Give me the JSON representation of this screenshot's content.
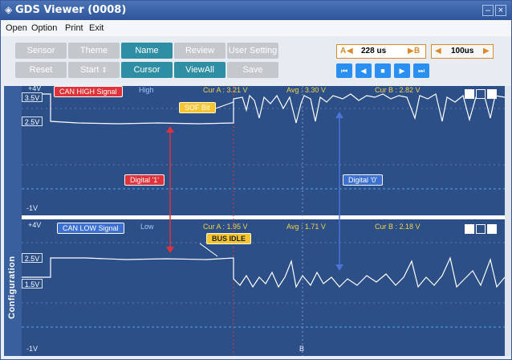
{
  "window": {
    "title": "GDS Viewer (0008)"
  },
  "menu": {
    "items": [
      "Open",
      "Option",
      "Print",
      "Exit"
    ]
  },
  "toolbar": {
    "row1": [
      "Sensor",
      "Theme",
      "Name",
      "Review",
      "User Setting"
    ],
    "row2": [
      "Reset",
      "Start",
      "Cursor",
      "ViewAll",
      "Save"
    ],
    "time_a_label": "A",
    "time_a_value": "228 us",
    "time_b_label": "B",
    "timebase_value": "100us"
  },
  "sidebar": {
    "label": "Configuration"
  },
  "top_channel": {
    "scale_top": "+4V",
    "scale_bottom": "-1V",
    "level_high": "3.5V",
    "level_low": "2.5V",
    "signal_name": "CAN HIGH Signal",
    "state": "High",
    "cur_a": "Cur A : 3.21 V",
    "avg": "Avg : 3.30 V",
    "cur_b": "Cur B : 2.82 V",
    "sof_label": "SOF Bit",
    "digital_1": "Digital '1'",
    "digital_0": "Digital '0'"
  },
  "bottom_channel": {
    "scale_top": "+4V",
    "scale_bottom": "-1V",
    "level_high": "2.5V",
    "level_low": "1.5V",
    "signal_name": "CAN LOW Signal",
    "state": "Low",
    "cur_a": "Cur A : 1.95 V",
    "avg": "Avg : 1.71 V",
    "cur_b": "Cur B : 2.18 V",
    "bus_idle": "BUS IDLE",
    "b_marker": "B"
  },
  "colors": {
    "scope_bg": "#2d4f87",
    "trace": "#ffffff",
    "cursor_a": "#e0323a",
    "accent_teal": "#2e8ea3",
    "nav_blue": "#2a8ff0"
  }
}
